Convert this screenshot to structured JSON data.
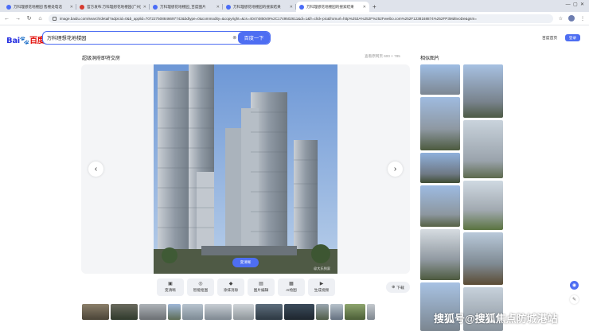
{
  "browser": {
    "tabs": [
      {
        "title": "万科理想花地楼园 售楼处电话",
        "active": false,
        "favicon": "baidu-paw-icon"
      },
      {
        "title": "官方发布:万科理想花地楼园(广州)",
        "active": false,
        "favicon": "baidu-red-icon"
      },
      {
        "title": "万科理想花地楼园_百度图片",
        "active": false,
        "favicon": "baidu-paw-icon"
      },
      {
        "title": "万科理想花地楼园的搜索结果",
        "active": false,
        "favicon": "baidu-paw-icon"
      },
      {
        "title": "万科理想花地楼园的搜索结果",
        "active": true,
        "favicon": "baidu-paw-icon"
      }
    ],
    "url": "image.baidu.com/search/detail?adpicid=0&b_applid=707227508846697742&bdtype=0&commodity=&copyright=&cs=4047485049%2C1749502611&di=1&fr=click-pic&fromurl=http%253A%252F%252Fweibo.com%252F1238168874%252FP3Md6voDe&gsm="
  },
  "header": {
    "logo": {
      "part1": "Bai",
      "paw": "🐾",
      "part2": "百度"
    },
    "search_query": "万科理想花地楼园",
    "search_button": "百度一下",
    "home_link": "百度首页",
    "login_button": "登录"
  },
  "viewer": {
    "title": "超级洞府即将交房",
    "meta": "查看原网页  600 × 785",
    "hd_button": "变清晰",
    "watermark_small": "@大乐到家"
  },
  "toolbar": [
    {
      "icon": "image-hd-icon",
      "glyph": "▣",
      "label": "变清晰"
    },
    {
      "icon": "smart-cutout-icon",
      "glyph": "◎",
      "label": "智能抠图"
    },
    {
      "icon": "eraser-icon",
      "glyph": "◆",
      "label": "涂抹消除"
    },
    {
      "icon": "image-edit-icon",
      "glyph": "▤",
      "label": "图片编辑"
    },
    {
      "icon": "ai-image-icon",
      "glyph": "▦",
      "label": "AI绘图"
    },
    {
      "icon": "video-icon",
      "glyph": "▶",
      "label": "生成视频"
    }
  ],
  "download_label": "下载",
  "related_title": "相似图片",
  "watermark": "搜狐号@搜狐焦点防城港站",
  "colors": {
    "accent": "#4e6ef2",
    "sky": "#7fa6dd",
    "building": "#9aa3ad"
  }
}
